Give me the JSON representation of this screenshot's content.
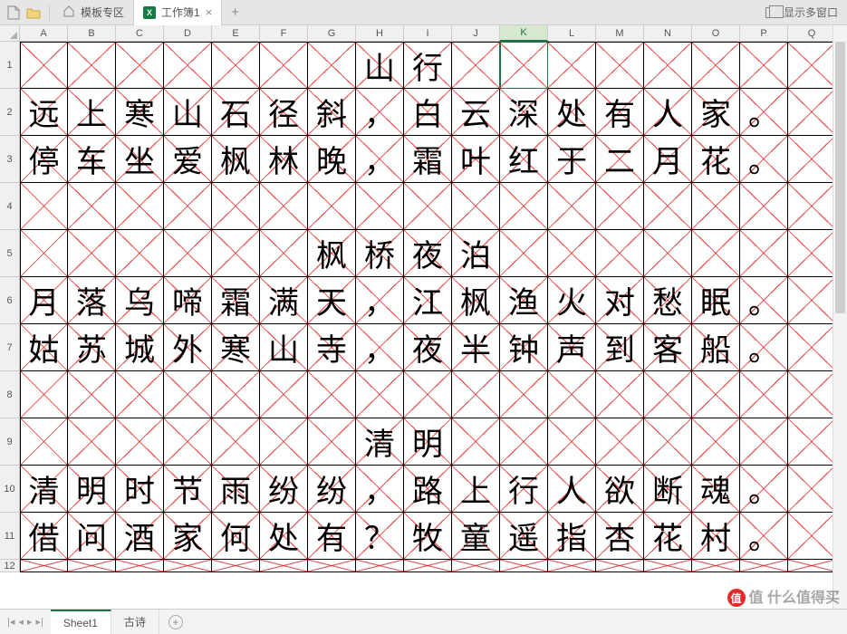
{
  "tabs": {
    "template_tab": "模板专区",
    "workbook_tab": "工作簿1",
    "multi_window": "显示多窗口"
  },
  "columns": [
    "A",
    "B",
    "C",
    "D",
    "E",
    "F",
    "G",
    "H",
    "I",
    "J",
    "K",
    "L",
    "M",
    "N",
    "O",
    "P",
    "Q"
  ],
  "selected_col": "K",
  "selected_cell": {
    "row": 1,
    "col": 11
  },
  "row_count": 12,
  "grid": {
    "r1": {
      "H": "山",
      "I": "行"
    },
    "r2": {
      "A": "远",
      "B": "上",
      "C": "寒",
      "D": "山",
      "E": "石",
      "F": "径",
      "G": "斜",
      "H": "，",
      "I": "白",
      "J": "云",
      "K": "深",
      "L": "处",
      "M": "有",
      "N": "人",
      "O": "家",
      "P": "。"
    },
    "r3": {
      "A": "停",
      "B": "车",
      "C": "坐",
      "D": "爱",
      "E": "枫",
      "F": "林",
      "G": "晚",
      "H": "，",
      "I": "霜",
      "J": "叶",
      "K": "红",
      "L": "于",
      "M": "二",
      "N": "月",
      "O": "花",
      "P": "。"
    },
    "r4": {},
    "r5": {
      "G": "枫",
      "H": "桥",
      "I": "夜",
      "J": "泊"
    },
    "r6": {
      "A": "月",
      "B": "落",
      "C": "乌",
      "D": "啼",
      "E": "霜",
      "F": "满",
      "G": "天",
      "H": "，",
      "I": "江",
      "J": "枫",
      "K": "渔",
      "L": "火",
      "M": "对",
      "N": "愁",
      "O": "眠",
      "P": "。"
    },
    "r7": {
      "A": "姑",
      "B": "苏",
      "C": "城",
      "D": "外",
      "E": "寒",
      "F": "山",
      "G": "寺",
      "H": "，",
      "I": "夜",
      "J": "半",
      "K": "钟",
      "L": "声",
      "M": "到",
      "N": "客",
      "O": "船",
      "P": "。"
    },
    "r8": {},
    "r9": {
      "H": "清",
      "I": "明"
    },
    "r10": {
      "A": "清",
      "B": "明",
      "C": "时",
      "D": "节",
      "E": "雨",
      "F": "纷",
      "G": "纷",
      "H": "，",
      "I": "路",
      "J": "上",
      "K": "行",
      "L": "人",
      "M": "欲",
      "N": "断",
      "O": "魂",
      "P": "。"
    },
    "r11": {
      "A": "借",
      "B": "问",
      "C": "酒",
      "D": "家",
      "E": "何",
      "F": "处",
      "G": "有",
      "H": "？",
      "I": "牧",
      "J": "童",
      "K": "遥",
      "L": "指",
      "M": "杏",
      "N": "花",
      "O": "村",
      "P": "。"
    }
  },
  "sheets": {
    "sheet1": "Sheet1",
    "sheet2": "古诗"
  },
  "watermark": "值  什么值得买"
}
